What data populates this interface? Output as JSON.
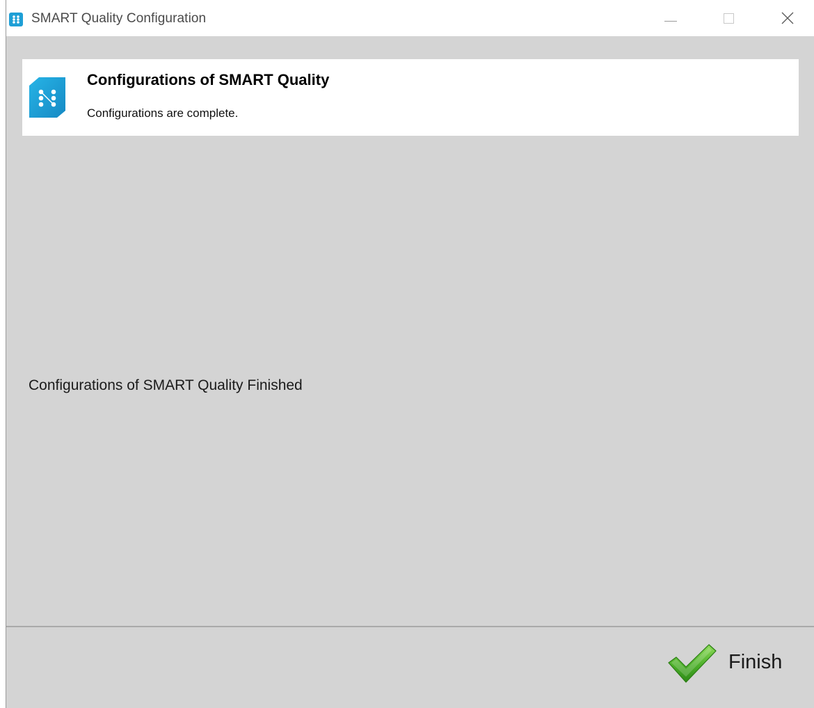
{
  "window": {
    "title": "SMART Quality Configuration",
    "controls": [
      "minimize",
      "maximize",
      "close"
    ]
  },
  "header": {
    "title": "Configurations of SMART Quality",
    "subtitle": "Configurations are complete.",
    "logo_icon": "smart-quality-logo-icon"
  },
  "main": {
    "message": "Configurations of SMART Quality Finished"
  },
  "footer": {
    "finish_label": "Finish",
    "finish_icon": "green-checkmark-icon"
  },
  "colors": {
    "window_bg": "#d4d4d4",
    "panel_bg": "#ffffff",
    "logo_blue": "#1e9fd6",
    "check_green": "#4caf2a"
  }
}
